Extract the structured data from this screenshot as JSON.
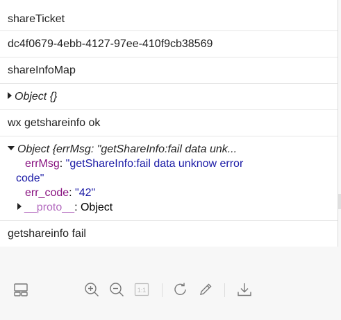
{
  "console": {
    "rows": [
      {
        "text": "shareTicket"
      },
      {
        "text": "dc4f0679-4ebb-4127-97ee-410f9cb38569"
      },
      {
        "text": "shareInfoMap"
      },
      {
        "text": "Object {}"
      },
      {
        "text": "wx getshareinfo ok"
      }
    ],
    "expanded": {
      "summary": "Object {errMsg: \"getShareInfo:fail data unk...",
      "err_msg_key": "errMsg",
      "err_msg_value_line1": "\"getShareInfo:fail data unknow error",
      "err_msg_value_line2": "code\"",
      "err_code_key": "err_code",
      "err_code_value": "\"42\"",
      "proto_key": "__proto__",
      "proto_value": "Object"
    },
    "last_row": "getshareinfo fail"
  },
  "toolbar": {
    "icons": [
      "layout-icon",
      "zoom-in-icon",
      "zoom-out-icon",
      "actual-size-icon",
      "rotate-icon",
      "edit-icon",
      "download-icon"
    ],
    "actual_size_label": "1:1"
  },
  "colors": {
    "key": "#881280",
    "string": "#1a1aa6",
    "proto": "#b36bbf",
    "toolbar_bg": "#f7f7f7"
  }
}
